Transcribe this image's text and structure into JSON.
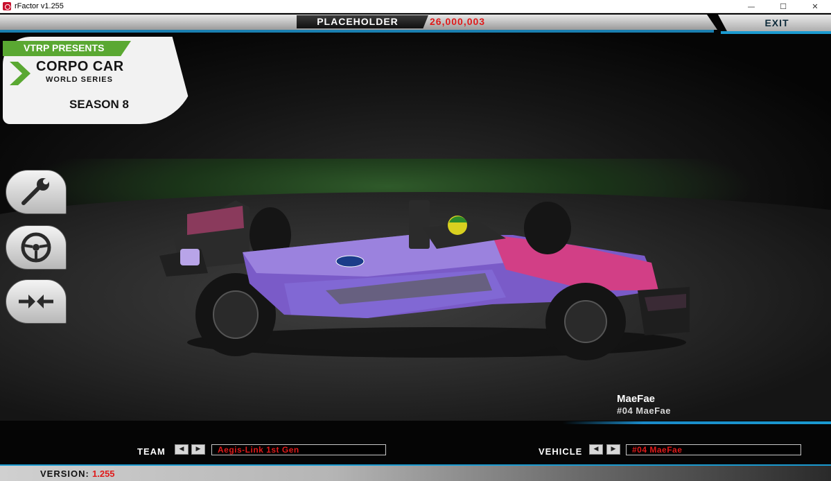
{
  "window": {
    "title": "rFactor v1.255",
    "minimize": "—",
    "maximize": "☐",
    "close": "✕"
  },
  "topbar": {
    "player_name": "PLACEHOLDER",
    "score": "26,000,003",
    "exit_label": "EXIT"
  },
  "logo": {
    "line1": "VTRP PRESENTS",
    "line2": "CORPO CAR",
    "line3": "WORLD SERIES",
    "line4": "SEASON 8"
  },
  "side_buttons": [
    {
      "icon": "wrench-icon"
    },
    {
      "icon": "steering-wheel-icon"
    },
    {
      "icon": "compare-arrows-icon"
    }
  ],
  "driver": {
    "name": "MaeFae",
    "number_name": "#04 MaeFae"
  },
  "selectors": {
    "team_label": "TEAM",
    "team_value": "Aegis-Link 1st Gen",
    "vehicle_label": "VEHICLE",
    "vehicle_value": "#04 MaeFae",
    "prev": "◀",
    "next": "▶"
  },
  "version": {
    "label": "VERSION:",
    "value": "1.255"
  },
  "colors": {
    "accent_cyan": "#1a9ad0",
    "accent_red": "#e01a1a",
    "logo_green": "#5aa832"
  }
}
